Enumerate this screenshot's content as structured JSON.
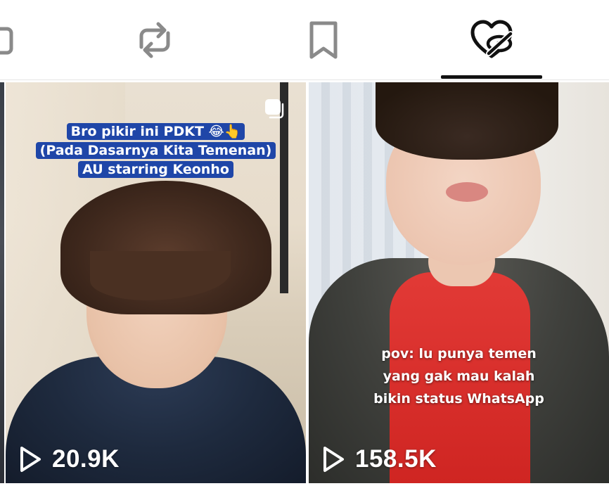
{
  "tabs": [
    {
      "id": "videos",
      "icon": "grid-icon",
      "active": false
    },
    {
      "id": "reposts",
      "icon": "repost-icon",
      "active": false
    },
    {
      "id": "favorites",
      "icon": "bookmark-icon",
      "active": false
    },
    {
      "id": "liked",
      "icon": "liked-heart-hidden-icon",
      "active": true
    }
  ],
  "colors": {
    "active_tab": "#111111",
    "inactive_icon": "#8a8a8a",
    "caption_bg": "#1f46a8"
  },
  "videos": [
    {
      "caption_lines": [
        "Bro pikir ini PDKT 😂👆",
        "(Pada Dasarnya Kita Temenan)",
        "AU starring Keonho"
      ],
      "views": "20.9K",
      "multi_photo": true
    },
    {
      "caption_lines": [
        "pov: lu punya temen",
        "yang gak mau kalah",
        "bikin status WhatsApp"
      ],
      "views": "158.5K",
      "multi_photo": false
    }
  ]
}
